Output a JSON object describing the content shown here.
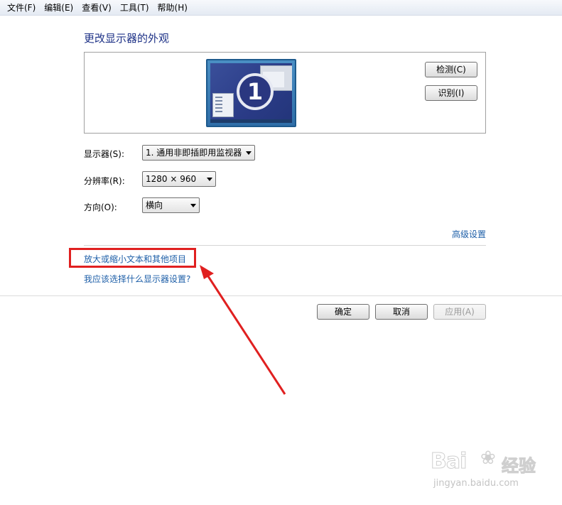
{
  "menu": [
    {
      "label": "文件(F)"
    },
    {
      "label": "编辑(E)"
    },
    {
      "label": "查看(V)"
    },
    {
      "label": "工具(T)"
    },
    {
      "label": "帮助(H)"
    }
  ],
  "page_title": "更改显示器的外观",
  "preview": {
    "monitor_number": "1",
    "detect_button": "检测(C)",
    "identify_button": "识别(I)"
  },
  "display": {
    "label": "显示器(S):",
    "value": "1. 通用非即插即用监视器"
  },
  "resolution": {
    "label": "分辨率(R):",
    "value": "1280 × 960"
  },
  "orientation": {
    "label": "方向(O):",
    "value": "横向"
  },
  "advanced_settings_link": "高级设置",
  "links": {
    "enlarge_text": "放大或缩小文本和其他项目",
    "which_settings": "我应该选择什么显示器设置?"
  },
  "footer": {
    "ok": "确定",
    "cancel": "取消",
    "apply": "应用(A)"
  },
  "watermark": {
    "brand": "Bai",
    "brand_cn": "经验",
    "url": "jingyan.baidu.com"
  },
  "colors": {
    "title": "#1e3287",
    "link": "#1e5fa8",
    "highlight": "#e02020"
  }
}
